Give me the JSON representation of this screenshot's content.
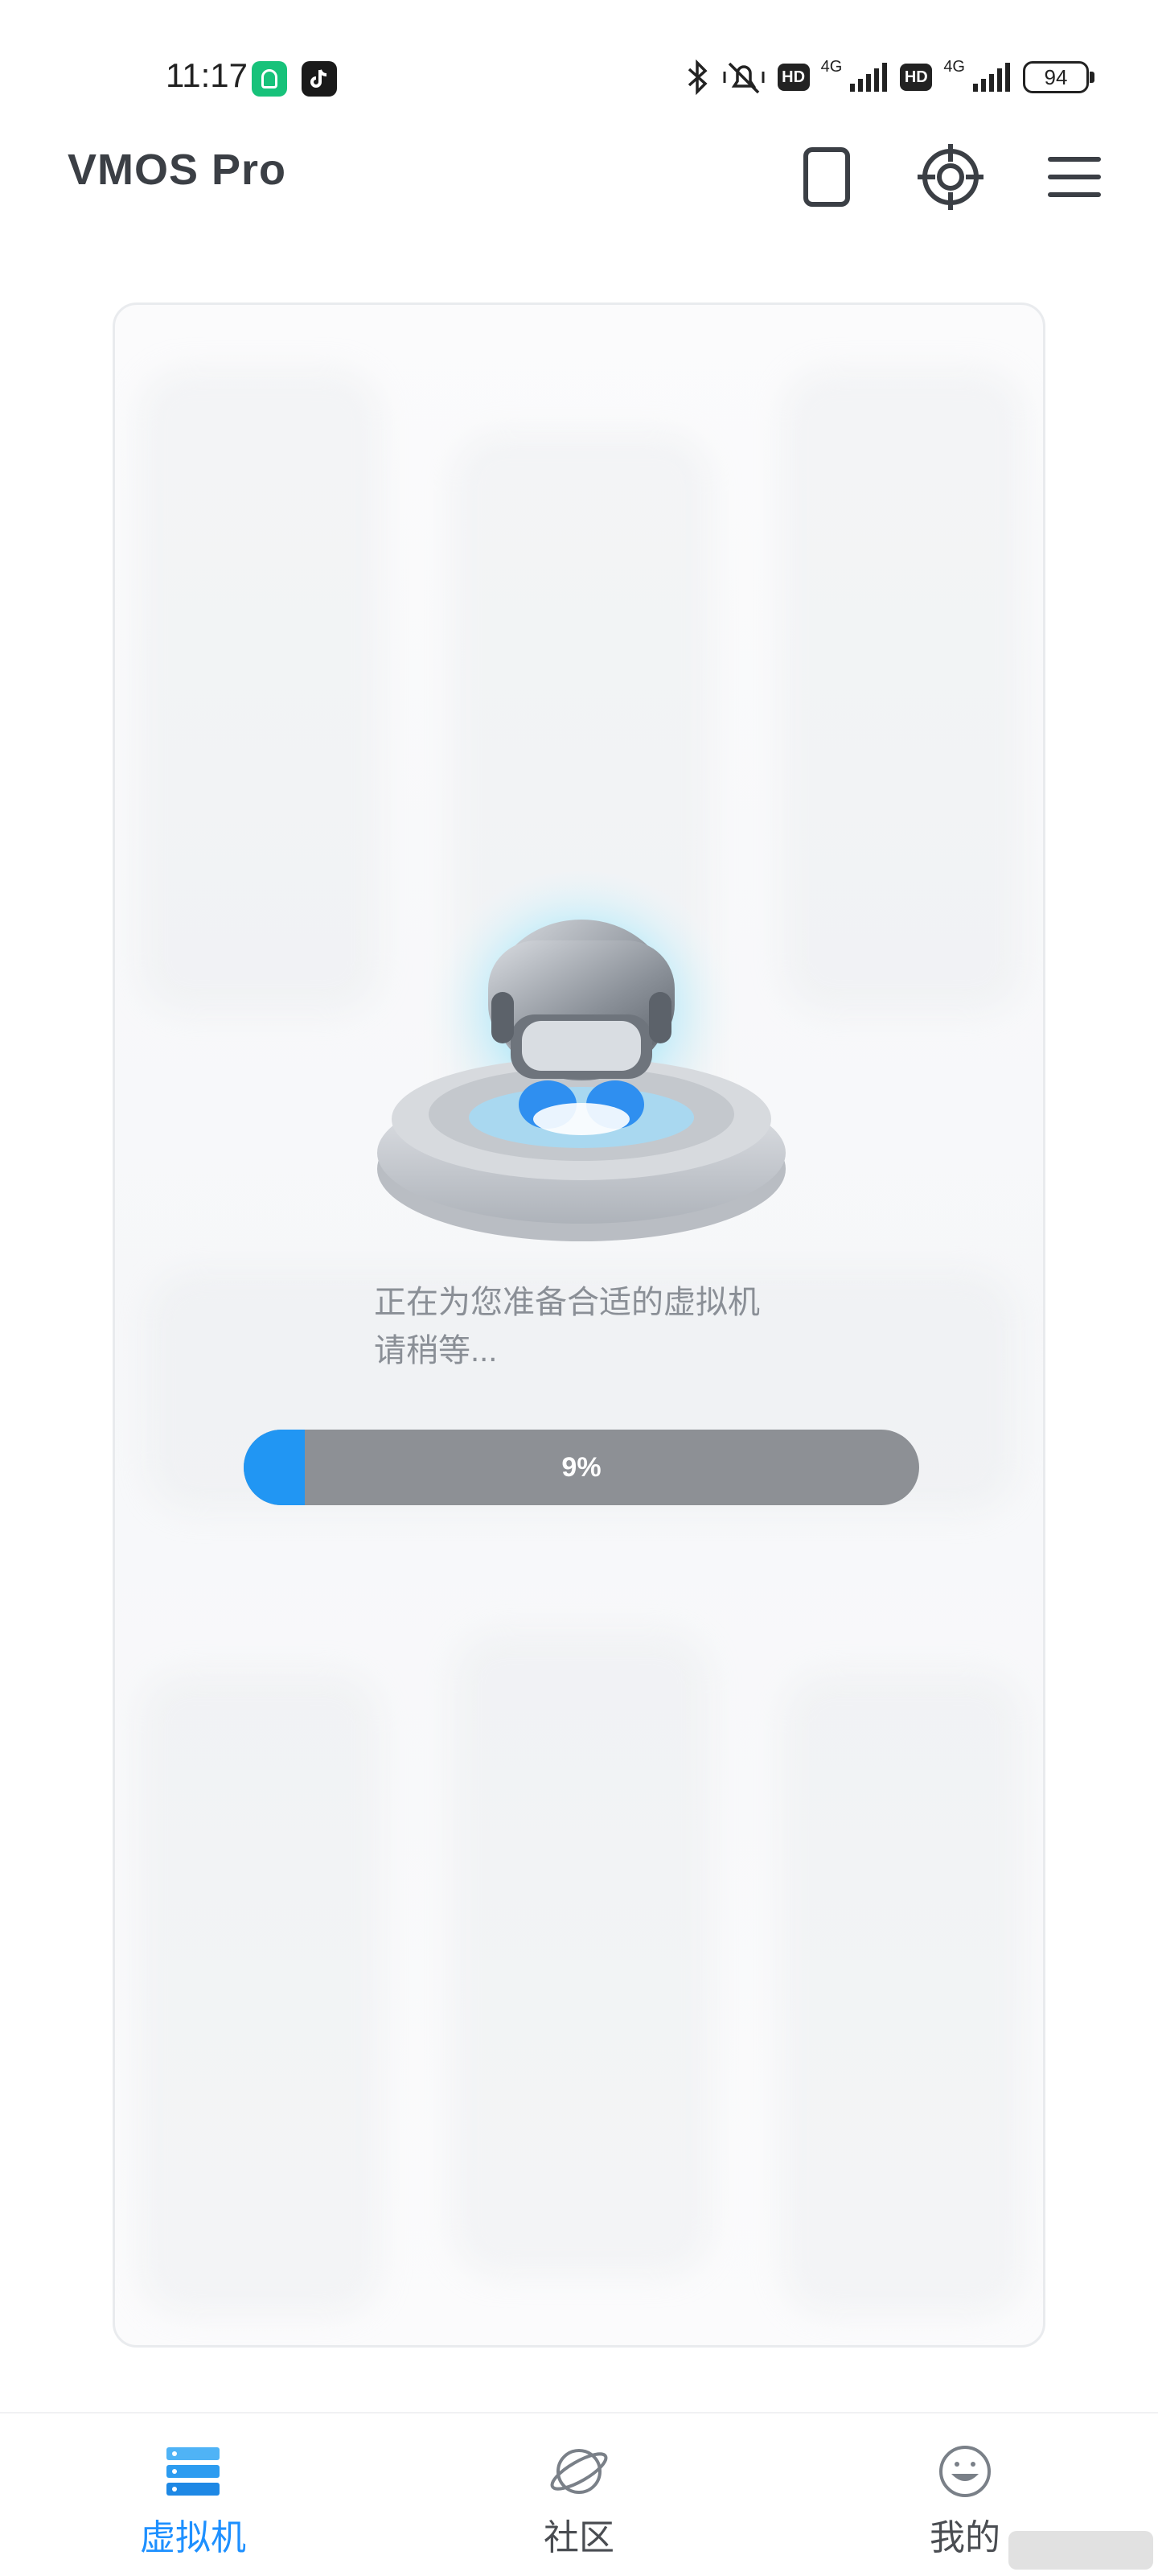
{
  "status_bar": {
    "time": "11:17",
    "battery": "94",
    "network_labels": [
      "4G",
      "4G"
    ],
    "hd_labels": [
      "HD",
      "HD"
    ],
    "icons": [
      "bluetooth-icon",
      "mute-icon",
      "signal-icon",
      "battery-icon"
    ]
  },
  "header": {
    "title": "VMOS  Pro",
    "buttons": [
      "phone-icon",
      "target-icon",
      "menu-icon"
    ]
  },
  "main": {
    "loading_line1": "正在为您准备合适的虚拟机",
    "loading_line2": "请稍等...",
    "progress_percent": 9,
    "progress_label": "9%"
  },
  "bottom_nav": {
    "items": [
      {
        "label": "虚拟机",
        "icon": "server-icon",
        "active": true
      },
      {
        "label": "社区",
        "icon": "planet-icon",
        "active": false
      },
      {
        "label": "我的",
        "icon": "smiley-icon",
        "active": false
      }
    ]
  },
  "colors": {
    "accent": "#2196f3",
    "progress_track": "#8d9095",
    "title_text": "#3b3f45"
  }
}
